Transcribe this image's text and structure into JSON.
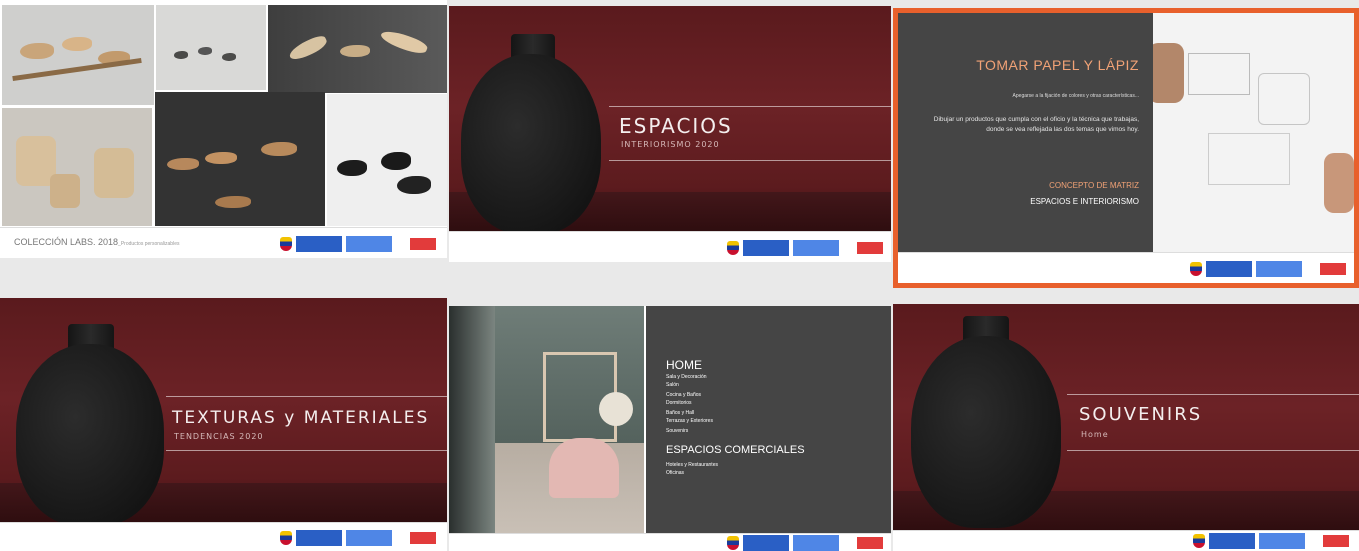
{
  "slides": {
    "coleccion": {
      "caption": "COLECCIÓN LABS. 2018",
      "caption_sub": "_Productos personalizables"
    },
    "espacios": {
      "title": "ESPACIOS",
      "subtitle": "INTERIORISMO 2020"
    },
    "tomar": {
      "title": "TOMAR PAPEL Y LÁPIZ",
      "line1": "Apegarse a la fijación de colores y otras características...",
      "body": "Dibujar un productos que cumpla con el oficio y la técnica que trabajas, donde se vea reflejada las dos temas que vimos hoy.",
      "concept": "CONCEPTO DE MATRIZ",
      "concept2": "ESPACIOS E INTERIORISMO"
    },
    "texturas": {
      "title": "TEXTURAS y MATERIALES",
      "subtitle": "TENDENCIAS 2020"
    },
    "home": {
      "heading": "HOME",
      "items": [
        "Sala y Decoración",
        "Salón",
        "Cocina y Baños",
        "Dormitorios",
        "Baños y Hall",
        "Terrazas y Exteriores",
        "Souvenirs"
      ],
      "heading2": "ESPACIOS COMERCIALES",
      "items2": [
        "Hoteles y Restaurantes",
        "Oficinas"
      ]
    },
    "souvenirs": {
      "title": "SOUVENIRS",
      "subtitle": "Home"
    }
  },
  "colors": {
    "maroon": "#6c2226",
    "panel": "#454545",
    "highlight_border": "#e8602c",
    "gov_blue": "#2a5fc5"
  }
}
